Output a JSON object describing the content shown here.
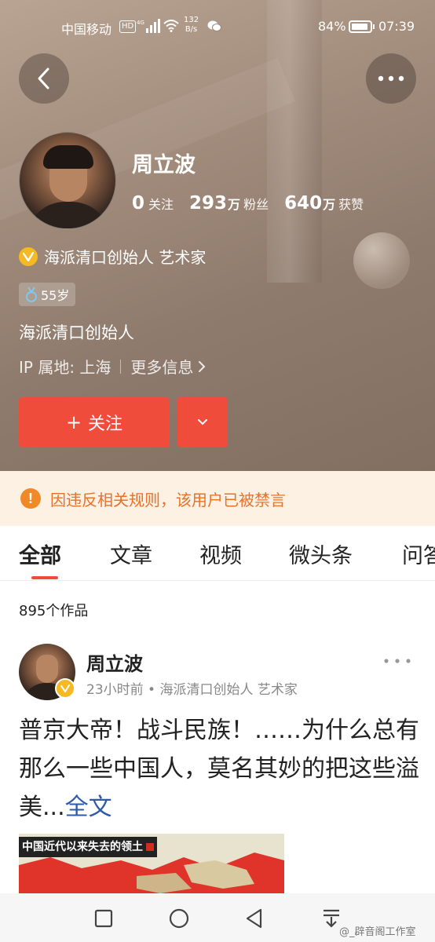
{
  "status_bar": {
    "carrier": "中国移动",
    "hd": "HD",
    "net_speed_value": "132",
    "net_speed_unit": "B/s",
    "battery": "84%",
    "time": "07:39"
  },
  "profile": {
    "name": "周立波",
    "stats": [
      {
        "num": "0",
        "unit": "",
        "label": "关注"
      },
      {
        "num": "293",
        "unit": "万",
        "label": "粉丝"
      },
      {
        "num": "640",
        "unit": "万",
        "label": "获赞"
      }
    ],
    "verification": "海派清口创始人 艺术家",
    "age": "55岁",
    "bio": "海派清口创始人",
    "ip": "IP 属地: 上海",
    "more_info": "更多信息",
    "follow_plus": "+",
    "follow_label": "关注"
  },
  "warning": "因违反相关规则，该用户已被禁言",
  "tabs": [
    "全部",
    "文章",
    "视频",
    "微头条",
    "问答"
  ],
  "works_count": "895个作品",
  "post": {
    "author": "周立波",
    "meta": "23小时前 • 海派清口创始人 艺术家",
    "text": "普京大帝！战斗民族！……为什么总有那么一些中国人，莫名其妙的把这些溢美...",
    "full_text_link": "全文",
    "image_title": "中国近代以来失去的领土"
  },
  "watermark": "@_辟音阁工作室",
  "colors": {
    "accent": "#f04c3c",
    "warning_text": "#e8712a",
    "warning_bg": "#fdf1e4",
    "link": "#2d5ba8",
    "verified_badge": "#f5b923"
  }
}
